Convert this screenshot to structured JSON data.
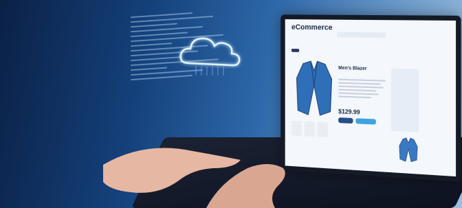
{
  "screen": {
    "brand": "eCommerce",
    "product_title": "Men's Blazer",
    "price": "$129.99",
    "accent": "#3fa3e0",
    "dark": "#1c2a4a"
  }
}
